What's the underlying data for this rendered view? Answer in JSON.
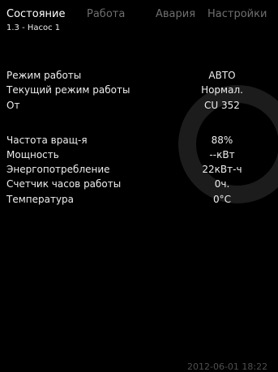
{
  "tabs": [
    {
      "label": "Состояние",
      "active": true
    },
    {
      "label": "Работа",
      "active": false
    },
    {
      "label": "Авария",
      "active": false
    },
    {
      "label": "Настройки",
      "active": false
    }
  ],
  "menu_id": "1.3 - Насос 1",
  "status_rows": [
    {
      "label": "Режим работы",
      "value": "АВТО"
    },
    {
      "label": "Текущий режим работы",
      "value": "Нормал."
    },
    {
      "label": "От",
      "value": "CU 352"
    }
  ],
  "measure_rows": [
    {
      "label": "Частота вращ-я",
      "value": "88%"
    },
    {
      "label": "Мощность",
      "value": "--кВт"
    },
    {
      "label": "Энергопотребление",
      "value": "22кВт-ч"
    },
    {
      "label": "Счетчик часов работы",
      "value": "0ч."
    },
    {
      "label": "Температура",
      "value": "0°C"
    }
  ],
  "datetime": "2012-06-01 18:22",
  "colors": {
    "background": "#000000",
    "text": "#ededed",
    "inactive_tab": "#6f6f6f",
    "watermark": "#1c1c1c"
  }
}
